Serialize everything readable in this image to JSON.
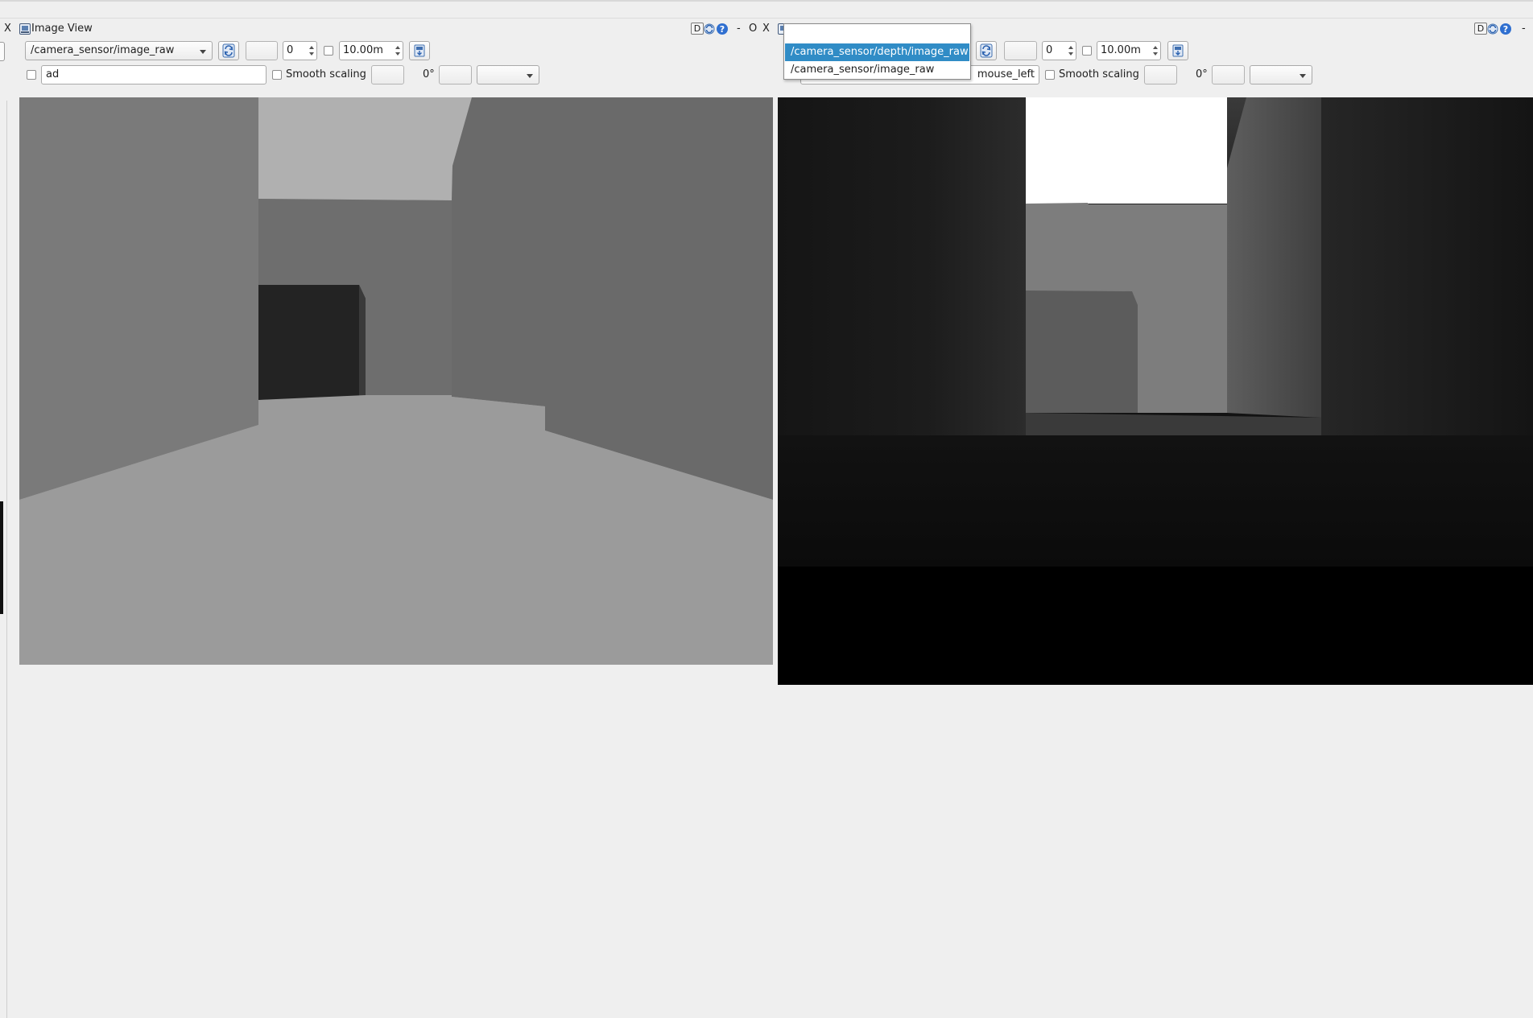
{
  "left_panel": {
    "close_glyph": "X",
    "title": "Image View",
    "topic_value": "/camera_sensor/image_raw",
    "spin_value": "0",
    "max_range_value": "10.00m",
    "mouse_topic_value": "ad",
    "smooth_label": "Smooth scaling",
    "rotation_value": "0°"
  },
  "right_panel": {
    "window_controls": {
      "minimize": "-",
      "restore": "O",
      "close": "X"
    },
    "dropdown_options": [
      {
        "label": "/camera_sensor/depth/image_raw",
        "selected": true
      },
      {
        "label": "/camera_sensor/image_raw",
        "selected": false
      }
    ],
    "spin_value": "0",
    "max_range_value": "10.00m",
    "mouse_topic_visible": "mouse_left",
    "smooth_label": "Smooth scaling",
    "rotation_value": "0°",
    "minimize_glyph": "-"
  },
  "help_buttons": {
    "dock_glyph": "D"
  },
  "colors": {
    "selection": "#308cc6",
    "background": "#efefef"
  }
}
